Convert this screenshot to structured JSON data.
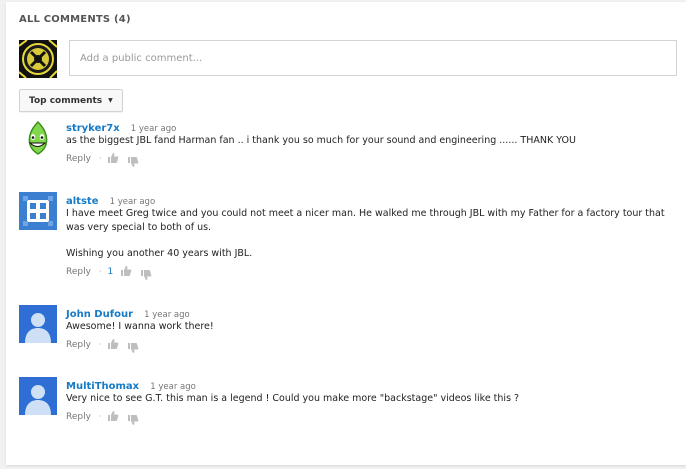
{
  "header": {
    "title": "ALL COMMENTS (4)"
  },
  "composer": {
    "placeholder": "Add a public comment..."
  },
  "sort": {
    "label": "Top comments"
  },
  "actions": {
    "reply_label": "Reply",
    "separator": "·"
  },
  "comments": [
    {
      "author": "stryker7x",
      "time": "1 year ago",
      "text": [
        "as the biggest JBL fand Harman fan .. i thank you so much for your sound and engineering ...... THANK YOU"
      ],
      "likes": "",
      "avatar_color": "#8fe34f"
    },
    {
      "author": "altste",
      "time": "1 year ago",
      "text": [
        "I have meet Greg twice and you could not meet a nicer man. He walked me through JBL with my Father for a factory tour that was very special to both of us.",
        "Wishing you another 40 years with JBL."
      ],
      "likes": "1",
      "avatar_color": "#3b7fd0"
    },
    {
      "author": "John Dufour",
      "time": "1 year ago",
      "text": [
        "Awesome!  I wanna work there!"
      ],
      "likes": "",
      "avatar_color": "#2f6fd5"
    },
    {
      "author": "MultiThomax",
      "time": "1 year ago",
      "text": [
        "Very nice to see G.T. this man is a legend ! Could you make more \"backstage\" videos like this ?"
      ],
      "likes": "",
      "avatar_color": "#2f6fd5"
    }
  ]
}
